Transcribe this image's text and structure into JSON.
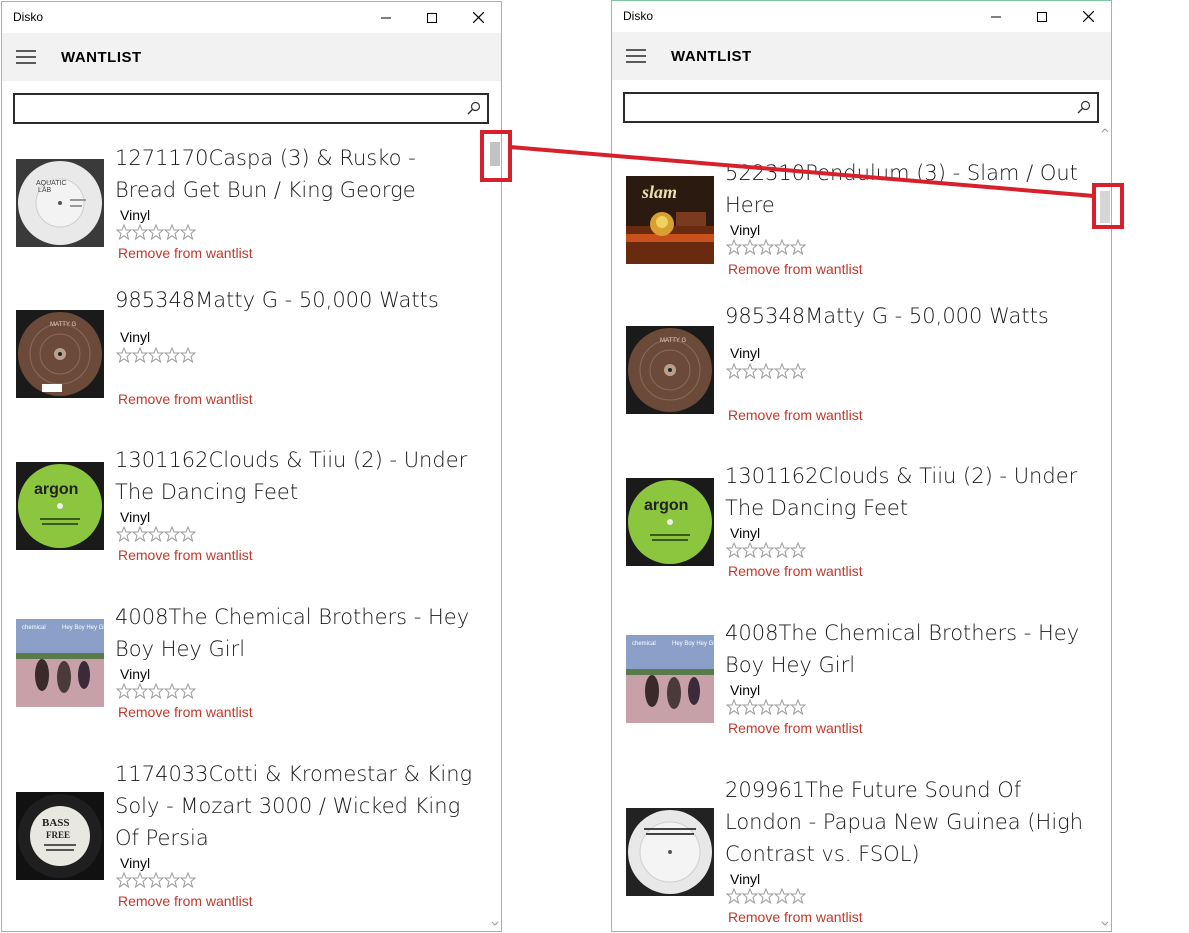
{
  "windows": {
    "left": {
      "app_title": "Disko",
      "page_title": "WANTLIST",
      "search": {
        "value": "",
        "placeholder": ""
      },
      "items": [
        {
          "title": "1271170Caspa (3) & Rusko - Bread Get Bun / King George",
          "format": "Vinyl",
          "remove_label": "Remove from wantlist",
          "rating": 0,
          "cover": "aquatic-lab"
        },
        {
          "title": "985348Matty G - 50,000 Watts",
          "format": "Vinyl",
          "remove_label": "Remove from wantlist",
          "rating": 0,
          "cover": "matty-g"
        },
        {
          "title": "1301162Clouds & Tiiu (2) - Under The Dancing Feet",
          "format": "Vinyl",
          "remove_label": "Remove from wantlist",
          "rating": 0,
          "cover": "argon"
        },
        {
          "title": "4008The Chemical Brothers - Hey Boy Hey Girl",
          "format": "Vinyl",
          "remove_label": "Remove from wantlist",
          "rating": 0,
          "cover": "chemical-brothers"
        },
        {
          "title": "1174033Cotti & Kromestar & King Soly - Mozart 3000 / Wicked King Of Persia",
          "format": "Vinyl",
          "remove_label": "Remove from wantlist",
          "rating": 0,
          "cover": "bass-dark"
        }
      ]
    },
    "right": {
      "app_title": "Disko",
      "page_title": "WANTLIST",
      "search": {
        "value": "",
        "placeholder": ""
      },
      "items": [
        {
          "title": "522310Pendulum (3) - Slam / Out Here",
          "format": "Vinyl",
          "remove_label": "Remove from wantlist",
          "rating": 0,
          "cover": "pendulum-slam"
        },
        {
          "title": "985348Matty G - 50,000 Watts",
          "format": "Vinyl",
          "remove_label": "Remove from wantlist",
          "rating": 0,
          "cover": "matty-g"
        },
        {
          "title": "1301162Clouds & Tiiu (2) - Under The Dancing Feet",
          "format": "Vinyl",
          "remove_label": "Remove from wantlist",
          "rating": 0,
          "cover": "argon"
        },
        {
          "title": "4008The Chemical Brothers - Hey Boy Hey Girl",
          "format": "Vinyl",
          "remove_label": "Remove from wantlist",
          "rating": 0,
          "cover": "chemical-brothers"
        },
        {
          "title": "209961The Future Sound Of London - Papua New Guinea (High Contrast vs. FSOL)",
          "format": "Vinyl",
          "remove_label": "Remove from wantlist",
          "rating": 0,
          "cover": "fsol-white"
        }
      ]
    }
  },
  "colors": {
    "window_border": "#7fc6a4",
    "appbar_bg": "#f2f2f2",
    "remove_link": "#c0392b",
    "annotation": "#d8202a",
    "scroll_thumb": "#c2c2c2"
  },
  "icons": {
    "menu": "hamburger-icon",
    "search": "search-icon",
    "minimize": "minimize-icon",
    "maximize": "maximize-icon",
    "close": "close-icon",
    "star": "star-outline-icon"
  }
}
